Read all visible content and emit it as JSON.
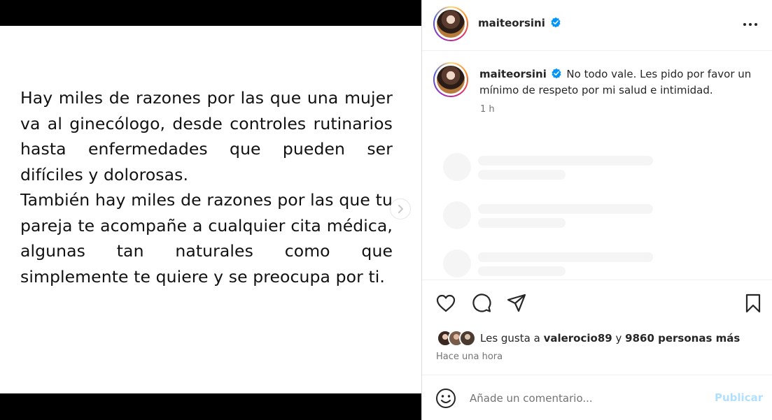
{
  "post": {
    "paragraph1": "Hay miles de razones por las que una mujer va al ginecólogo, desde controles rutinarios hasta enfermedades que pueden ser difíciles y dolorosas.",
    "paragraph2": "También hay miles de razones por las que tu pareja te acompañe a cualquier cita médica, algunas tan naturales como que simplemente te quiere y se preocupa por ti."
  },
  "header": {
    "username": "maiteorsini"
  },
  "caption": {
    "username": "maiteorsini",
    "text": "No todo vale. Les pido por favor un mínimo de respeto por mi salud e intimidad.",
    "time": "1 h"
  },
  "likes": {
    "prefix": "Les gusta a",
    "user": "valerocio89",
    "connector": "y",
    "count_text": "9860 personas más"
  },
  "timestamp": "Hace una hora",
  "comment": {
    "placeholder": "Añade un comentario...",
    "post_label": "Publicar"
  },
  "icons": [
    "chevron-right-icon",
    "more-icon",
    "verified-icon",
    "heart-icon",
    "comment-icon",
    "share-icon",
    "bookmark-icon",
    "emoji-icon"
  ],
  "colors": {
    "verified": "#0095f6",
    "post_disabled": "#b2dffc",
    "muted": "#737373"
  }
}
